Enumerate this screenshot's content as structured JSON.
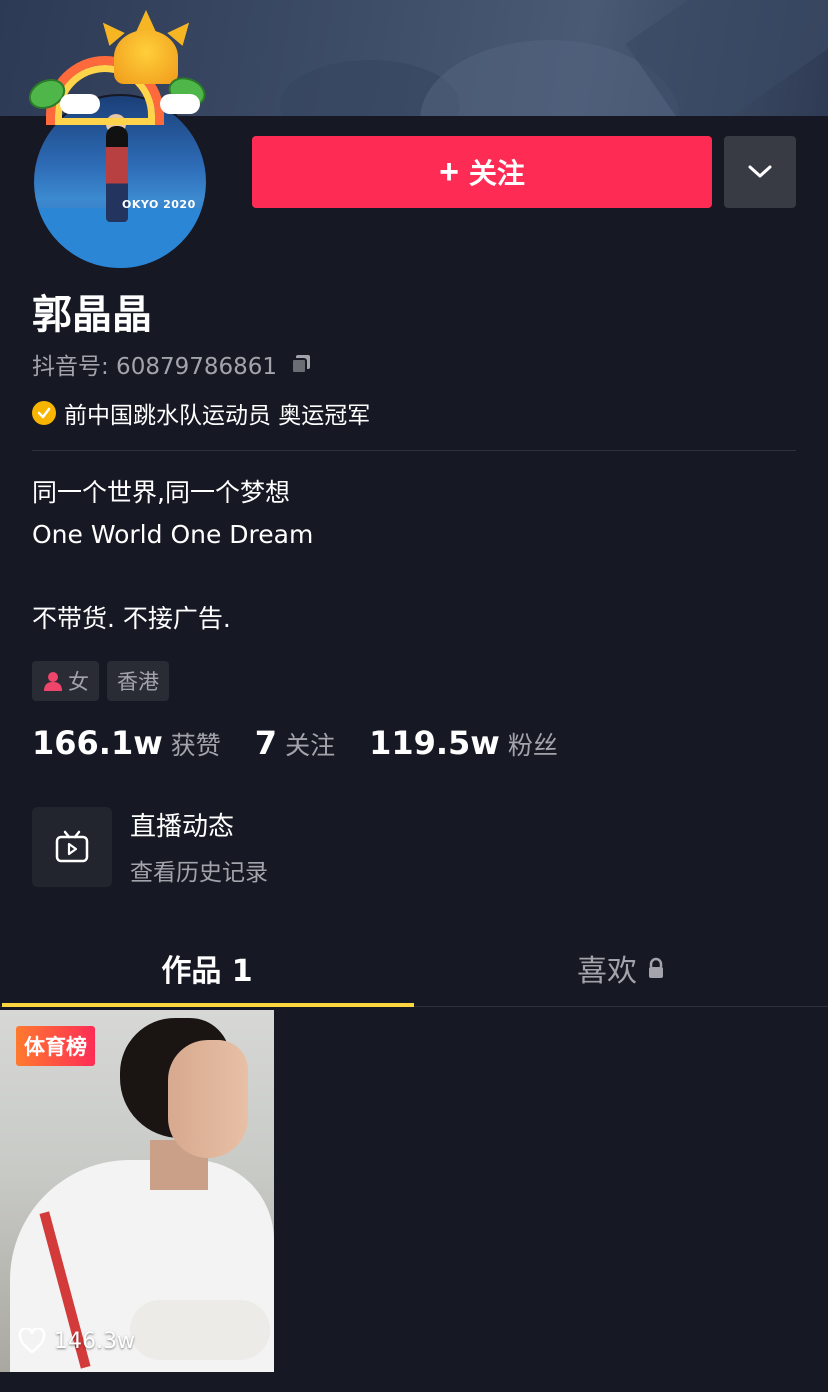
{
  "profile": {
    "name": "郭晶晶",
    "douyin_id": "抖音号: 60879786861",
    "verification": "前中国跳水队运动员 奥运冠军",
    "avatar_sign": "OKYO 2020"
  },
  "actions": {
    "follow_label": "关注",
    "follow_color": "#fe2c55"
  },
  "bio": {
    "line1": "同一个世界,同一个梦想",
    "line2": "One World One Dream",
    "line3": "不带货. 不接广告."
  },
  "tags": [
    {
      "icon": "female-icon",
      "label": "女"
    },
    {
      "label": "香港"
    }
  ],
  "stats": [
    {
      "value": "166.1w",
      "label": "获赞"
    },
    {
      "value": "7",
      "label": "关注"
    },
    {
      "value": "119.5w",
      "label": "粉丝"
    }
  ],
  "live": {
    "title": "直播动态",
    "subtitle": "查看历史记录"
  },
  "tabs": [
    {
      "label": "作品 1",
      "active": true
    },
    {
      "label": "喜欢",
      "locked": true
    }
  ],
  "videos": [
    {
      "badge": "体育榜",
      "likes": "146.3w"
    }
  ],
  "colors": {
    "background": "#161823",
    "accent": "#fe2c55",
    "tab_indicator": "#fcd53f",
    "verify_badge": "#f7b500"
  }
}
